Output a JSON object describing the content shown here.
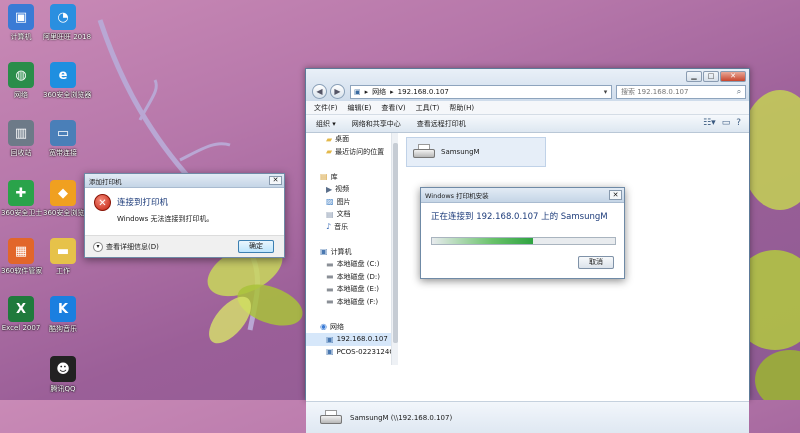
{
  "desktop": {
    "icons": [
      {
        "label": "计算机",
        "glyph": "▣",
        "color": "#3a7bd5"
      },
      {
        "label": "网络",
        "glyph": "◍",
        "color": "#2a8d4a"
      },
      {
        "label": "回收站",
        "glyph": "▥",
        "color": "#6d7a88"
      },
      {
        "label": "360安全卫士",
        "glyph": "✚",
        "color": "#2aa34a"
      },
      {
        "label": "360软件管家",
        "glyph": "▦",
        "color": "#e2662a"
      },
      {
        "label": "Excel 2007",
        "glyph": "X",
        "color": "#1f7a3c"
      }
    ],
    "icons2": [
      {
        "label": "阿里旺旺 2018",
        "glyph": "◔",
        "color": "#2a8fe0"
      },
      {
        "label": "360安全浏览器",
        "glyph": "e",
        "color": "#1f8fe0"
      },
      {
        "label": "宽带连接",
        "glyph": "▭",
        "color": "#4a7fb8"
      },
      {
        "label": "360安全浏览器",
        "glyph": "◆",
        "color": "#f0a020"
      },
      {
        "label": "工作",
        "glyph": "▬",
        "color": "#e6c24a"
      },
      {
        "label": "酷狗音乐",
        "glyph": "K",
        "color": "#1a7fe0"
      },
      {
        "label": "腾讯QQ",
        "glyph": "☻",
        "color": "#222"
      }
    ]
  },
  "explorer": {
    "address": {
      "segments": [
        "网络",
        "192.168.0.107"
      ]
    },
    "search_placeholder": "搜索 192.168.0.107",
    "menu": [
      "文件(F)",
      "编辑(E)",
      "查看(V)",
      "工具(T)",
      "帮助(H)"
    ],
    "commands": [
      "组织 ▾",
      "网络和共享中心",
      "查看远程打印机"
    ],
    "nav": [
      {
        "label": "桌面",
        "icon": "folder"
      },
      {
        "label": "最近访问的位置",
        "icon": "folder"
      },
      {
        "label": "",
        "icon": ""
      },
      {
        "label": "库",
        "icon": "library"
      },
      {
        "label": "视频",
        "icon": "video"
      },
      {
        "label": "图片",
        "icon": "picture"
      },
      {
        "label": "文档",
        "icon": "document"
      },
      {
        "label": "音乐",
        "icon": "music"
      },
      {
        "label": "",
        "icon": ""
      },
      {
        "label": "计算机",
        "icon": "computer"
      },
      {
        "label": "本地磁盘 (C:)",
        "icon": "drive"
      },
      {
        "label": "本地磁盘 (D:)",
        "icon": "drive"
      },
      {
        "label": "本地磁盘 (E:)",
        "icon": "drive"
      },
      {
        "label": "本地磁盘 (F:)",
        "icon": "drive"
      },
      {
        "label": "",
        "icon": ""
      },
      {
        "label": "网络",
        "icon": "network"
      },
      {
        "label": "192.168.0.107",
        "icon": "computer"
      },
      {
        "label": "PCOS-0223124C",
        "icon": "computer"
      }
    ],
    "printer_name": "SamsungM",
    "details_text": "SamsungM (\\\\192.168.0.107)"
  },
  "install_dialog": {
    "title": "Windows 打印机安装",
    "message": "正在连接到 192.168.0.107 上的 SamsungM",
    "progress": 0.55,
    "cancel_label": "取消"
  },
  "add_printer_dialog": {
    "title": "添加打印机",
    "heading": "连接到打印机",
    "message": "Windows 无法连接到打印机。",
    "details_label": "查看详细信息(D)",
    "ok_label": "确定"
  }
}
